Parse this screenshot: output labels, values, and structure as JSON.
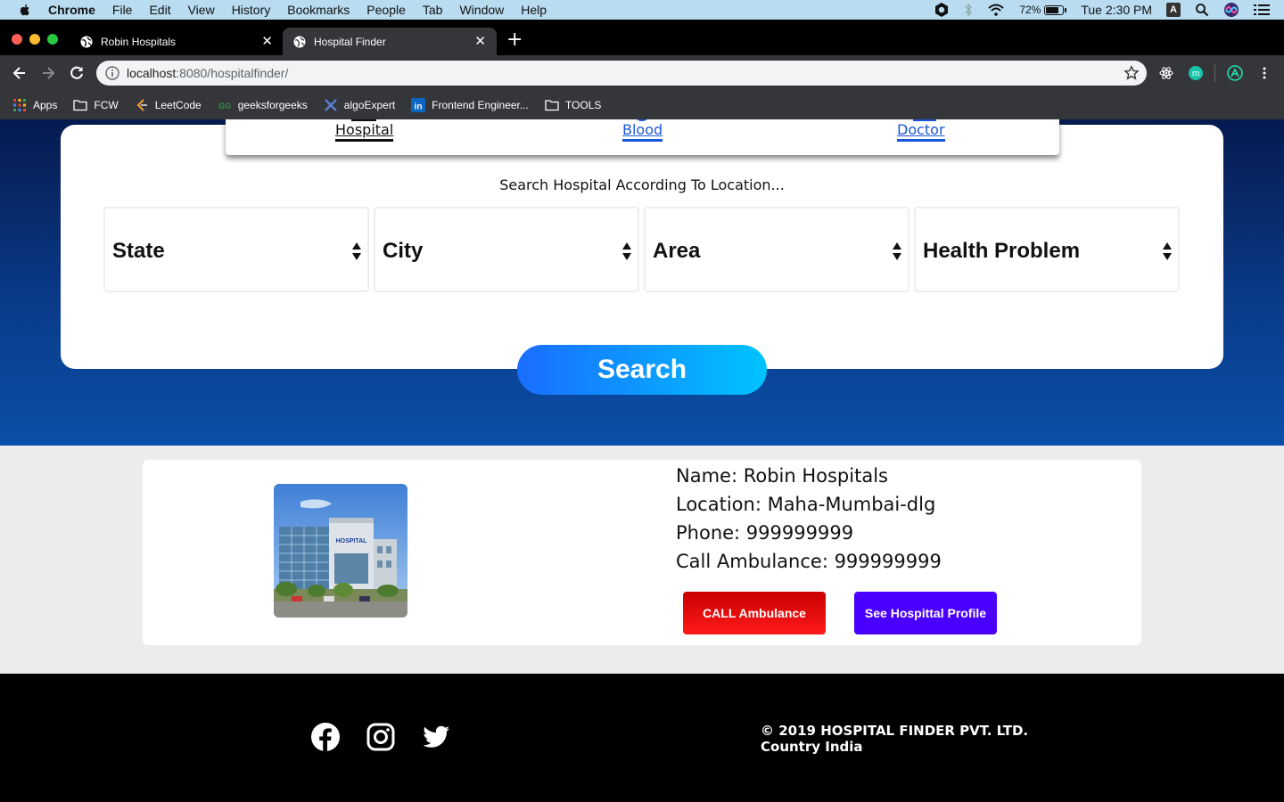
{
  "menubar": {
    "app": "Chrome",
    "items": [
      "File",
      "Edit",
      "View",
      "History",
      "Bookmarks",
      "People",
      "Tab",
      "Window",
      "Help"
    ],
    "battery": "72%",
    "clock": "Tue 2:30 PM",
    "input_source": "A"
  },
  "tabs": [
    {
      "title": "Robin Hospitals",
      "active": false
    },
    {
      "title": "Hospital Finder",
      "active": true
    }
  ],
  "address": {
    "host": "localhost",
    "path": ":8080/hospitalfinder/"
  },
  "bookmarks": [
    {
      "label": "Apps",
      "icon": "apps-grid-icon"
    },
    {
      "label": "FCW",
      "icon": "folder-icon"
    },
    {
      "label": "LeetCode",
      "icon": "leetcode-icon"
    },
    {
      "label": "geeksforgeeks",
      "icon": "gfg-icon"
    },
    {
      "label": "algoExpert",
      "icon": "algoexpert-icon"
    },
    {
      "label": "Frontend Engineer...",
      "icon": "linkedin-icon"
    },
    {
      "label": "TOOLS",
      "icon": "folder-icon"
    }
  ],
  "search_tabs": [
    {
      "label": "Hospital",
      "active": true
    },
    {
      "label": "Blood",
      "active": false
    },
    {
      "label": "Doctor",
      "active": false
    }
  ],
  "search": {
    "caption": "Search Hospital According To Location...",
    "selects": [
      "State",
      "City",
      "Area",
      "Health Problem"
    ],
    "button": "Search"
  },
  "result": {
    "name": "Name: Robin Hospitals",
    "location": "Location: Maha-Mumbai-dlg",
    "phone": "Phone: 999999999",
    "ambulance": "Call Ambulance: 999999999",
    "image_sign": "HOSPITAL",
    "call_button": "CALL Ambulance",
    "profile_button": "See Hospittal Profile"
  },
  "footer": {
    "copyright": "© 2019 HOSPITAL FINDER PVT. LTD.",
    "country": "Country India",
    "social": [
      "facebook-icon",
      "instagram-icon",
      "twitter-icon"
    ]
  },
  "colors": {
    "hero_top": "#061a4f",
    "hero_bottom": "#0a4fa8",
    "search_gradient_start": "#1a6dff",
    "search_gradient_end": "#00c3ff",
    "call_button": "#e00000",
    "profile_button": "#4a00ff",
    "tab_link": "#1a56d9"
  }
}
